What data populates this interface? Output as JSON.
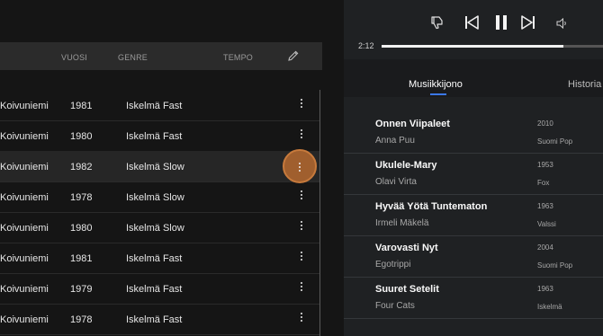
{
  "table": {
    "headers": {
      "year": "VUOSI",
      "genre": "GENRE",
      "tempo": "TEMPO"
    },
    "rows": [
      {
        "artist": "Koivuniemi",
        "year": "1981",
        "genre": "Iskelmä Fast"
      },
      {
        "artist": "Koivuniemi",
        "year": "1980",
        "genre": "Iskelmä Fast"
      },
      {
        "artist": "Koivuniemi",
        "year": "1982",
        "genre": "Iskelmä Slow"
      },
      {
        "artist": "Koivuniemi",
        "year": "1978",
        "genre": "Iskelmä Slow"
      },
      {
        "artist": "Koivuniemi",
        "year": "1980",
        "genre": "Iskelmä Slow"
      },
      {
        "artist": "Koivuniemi",
        "year": "1981",
        "genre": "Iskelmä Fast"
      },
      {
        "artist": "Koivuniemi",
        "year": "1979",
        "genre": "Iskelmä Fast"
      },
      {
        "artist": "Koivuniemi",
        "year": "1978",
        "genre": "Iskelmä Fast"
      }
    ]
  },
  "player": {
    "elapsed": "2:12",
    "progress": 0.82
  },
  "tabs": {
    "queue": "Musiikkijono",
    "history": "Historia"
  },
  "queue": [
    {
      "title": "Onnen Viipaleet",
      "artist": "Anna Puu",
      "year": "2010",
      "genre": "Suomi Pop"
    },
    {
      "title": "Ukulele-Mary",
      "artist": "Olavi Virta",
      "year": "1953",
      "genre": "Fox"
    },
    {
      "title": "Hyvää Yötä Tuntematon",
      "artist": "Irmeli Mäkelä",
      "year": "1963",
      "genre": "Valssi"
    },
    {
      "title": "Varovasti Nyt",
      "artist": "Egotrippi",
      "year": "2004",
      "genre": "Suomi Pop"
    },
    {
      "title": "Suuret Setelit",
      "artist": "Four Cats",
      "year": "1963",
      "genre": "Iskelmä"
    }
  ]
}
